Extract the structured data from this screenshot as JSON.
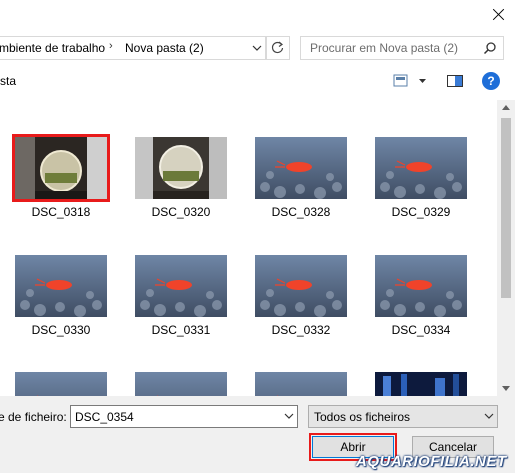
{
  "address": {
    "crumb1": "mbiente de trabalho",
    "crumb2": "Nova pasta (2)",
    "separator": "›"
  },
  "search": {
    "placeholder": "Procurar em Nova pasta (2)"
  },
  "toolbar": {
    "organize_fragment": "sta"
  },
  "files": [
    {
      "name": "DSC_0318",
      "kind": "bowl-dark",
      "selected": true
    },
    {
      "name": "DSC_0320",
      "kind": "bowl"
    },
    {
      "name": "DSC_0328",
      "kind": "shrimp"
    },
    {
      "name": "DSC_0329",
      "kind": "shrimp"
    },
    {
      "name": "DSC_0330",
      "kind": "shrimp"
    },
    {
      "name": "DSC_0331",
      "kind": "shrimp"
    },
    {
      "name": "DSC_0332",
      "kind": "shrimp"
    },
    {
      "name": "DSC_0334",
      "kind": "shrimp"
    },
    {
      "name": "",
      "kind": "shrimp"
    },
    {
      "name": "",
      "kind": "shrimp"
    },
    {
      "name": "",
      "kind": "shrimp"
    },
    {
      "name": "",
      "kind": "tank"
    }
  ],
  "filename": {
    "label": "e de ficheiro:",
    "value": "DSC_0354"
  },
  "filter": {
    "value": "Todos os ficheiros"
  },
  "buttons": {
    "open": "Abrir",
    "cancel": "Cancelar"
  },
  "watermark": "AQUARIOFILIA.NET",
  "colors": {
    "selection_outline": "#e81b1b",
    "help_icon": "#1e6ed8"
  }
}
